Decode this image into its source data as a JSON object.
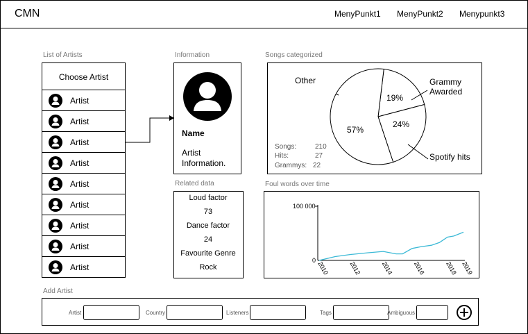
{
  "header": {
    "logo": "CMN",
    "menu": [
      "MenyPunkt1",
      "MenyPunkt2",
      "Menypunkt3"
    ]
  },
  "artists": {
    "section_label": "List of Artists",
    "choose_label": "Choose Artist",
    "items": [
      "Artist",
      "Artist",
      "Artist",
      "Artist",
      "Artist",
      "Artist",
      "Artist",
      "Artist",
      "Artist"
    ]
  },
  "information": {
    "section_label": "Information",
    "name": "Name",
    "details_line1": "Artist",
    "details_line2": "Information."
  },
  "related": {
    "section_label": "Related data",
    "loud_label": "Loud factor",
    "loud_value": "73",
    "dance_label": "Dance factor",
    "dance_value": "24",
    "genre_label": "Favourite Genre",
    "genre_value": "Rock"
  },
  "songs": {
    "section_label": "Songs categorized",
    "stats": {
      "songs_label": "Songs:",
      "songs_value": "210",
      "hits_label": "Hits:",
      "hits_value": "27",
      "grammys_label": "Grammys:",
      "grammys_value": "22"
    }
  },
  "foul": {
    "section_label": "Foul words over time"
  },
  "add_artist": {
    "section_label": "Add Artist",
    "fields": [
      "Artist",
      "Country",
      "Listeners",
      "Tags",
      "Ambiguous"
    ],
    "add_icon": "plus-circle-icon"
  },
  "chart_data": [
    {
      "type": "pie",
      "title": "",
      "labels": [
        "Other",
        "Grammy Awarded",
        "Spotify hits"
      ],
      "values": [
        57,
        19,
        24
      ],
      "value_labels": [
        "57%",
        "19%",
        "24%"
      ]
    },
    {
      "type": "line",
      "title": "",
      "xlabel": "",
      "ylabel": "",
      "x_ticks": [
        "2010",
        "2012",
        "2014",
        "2016",
        "2018",
        "2019"
      ],
      "y_ticks": [
        "0",
        "100 000"
      ],
      "ylim": [
        0,
        100000
      ],
      "xlim": [
        2010,
        2019
      ],
      "series": [
        {
          "color": "#3bb9d6",
          "x": [
            2010,
            2011,
            2012,
            2013,
            2014,
            2014.8,
            2015.2,
            2015.8,
            2016.3,
            2017,
            2017.5,
            2018,
            2018.4,
            2019
          ],
          "y": [
            0,
            7000,
            11000,
            14000,
            16500,
            12000,
            12000,
            22000,
            25000,
            28000,
            33000,
            43000,
            45000,
            52000
          ]
        }
      ],
      "line_color": "#3bb9d6"
    }
  ]
}
